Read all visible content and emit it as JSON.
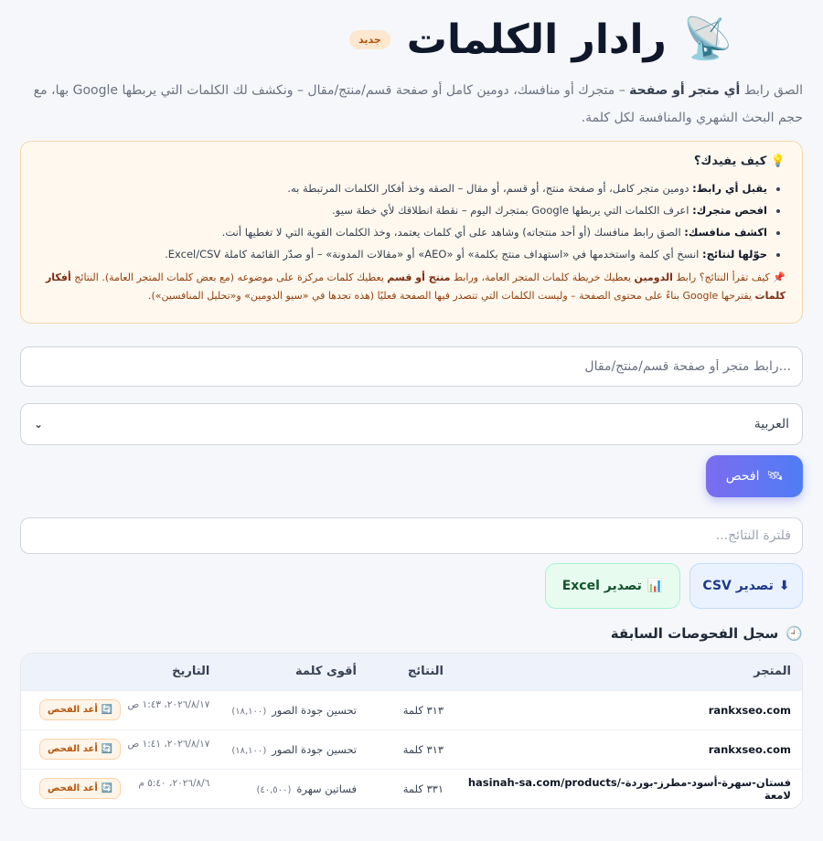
{
  "header": {
    "title": "رادار الكلمات",
    "badge": "جديد",
    "icon": "satellite-dish-icon",
    "subtitle_part1": "الصق رابط ",
    "subtitle_bold": "أي متجر أو صفحة",
    "subtitle_part2": " – متجرك أو منافسك، دومين كامل أو صفحة قسم/منتج/مقال – ونكشف لك الكلمات التي يربطها Google بها، مع حجم البحث الشهري والمنافسة لكل كلمة."
  },
  "info": {
    "title": "💡 كيف يفيدك؟",
    "items": [
      {
        "bold": "يقبل أي رابط:",
        "text": " دومين متجر كامل، أو صفحة منتج، أو قسم، أو مقال – الصقه وخذ أفكار الكلمات المرتبطة به."
      },
      {
        "bold": "افحص متجرك:",
        "text": " اعرف الكلمات التي يربطها Google بمتجرك اليوم – نقطة انطلاقك لأي خطة سيو."
      },
      {
        "bold": "اكشف منافسك:",
        "text": " الصق رابط منافسك (أو أحد منتجاته) وشاهد على أي كلمات يعتمد، وخذ الكلمات القوية التي لا تغطيها أنت."
      },
      {
        "bold": "حوّلها لنتائج:",
        "text": " انسخ أي كلمة واستخدمها في «استهداف منتج بكلمة» أو «AEO» أو «مقالات المدونة» – أو صدّر القائمة كاملة Excel/CSV."
      }
    ],
    "note_a": "📌 كيف تقرأ النتائج؟ رابط ",
    "note_b1": "الدومين",
    "note_c": " يعطيك خريطة كلمات المتجر العامة، ورابط ",
    "note_b2": "منتج أو قسم",
    "note_d": " يعطيك كلمات مركزة على موضوعه (مع بعض كلمات المتجر العامة). النتائج ",
    "note_b3": "أفكار كلمات",
    "note_e": " يقترحها Google بناءً على محتوى الصفحة – وليست الكلمات التي تتصدر فيها الصفحة فعليًا (هذه تجدها في «سيو الدومين» و«تحليل المنافسين»)."
  },
  "form": {
    "url_placeholder": "...رابط متجر أو صفحة قسم/منتج/مقال",
    "language": "العربية",
    "scan_label": "افحص",
    "scan_icon": "🛰",
    "filter_placeholder": "فلترة النتائج..."
  },
  "export": {
    "csv_label": "تصدير CSV",
    "csv_icon": "⬇",
    "excel_label": "تصدير Excel",
    "excel_icon": "📊"
  },
  "history": {
    "title": "سجل الفحوصات السابقة",
    "icon": "🕘",
    "columns": [
      "المتجر",
      "النتائج",
      "أقوى كلمة",
      "التاريخ"
    ],
    "rescan_label": "أعد الفحص",
    "rescan_icon": "🔄",
    "rows": [
      {
        "store": "rankxseo.com",
        "results": "٣١٣ كلمة",
        "keyword": "تحسين جودة الصور",
        "metric": "(١٨,١٠٠)",
        "date": "٢٠٢٦/٨/١٧، ١:٤٣ ص"
      },
      {
        "store": "rankxseo.com",
        "results": "٣١٣ كلمة",
        "keyword": "تحسين جودة الصور",
        "metric": "(١٨,١٠٠)",
        "date": "٢٠٢٦/٨/١٧، ١:٤١ ص"
      },
      {
        "store": "hasinah-sa.com/products/فستان-سهرة-أسود-مطرز-بوردة-لامعة",
        "results": "٣٣١ كلمة",
        "keyword": "فساتين سهرة",
        "metric": "(٤٠,٥٠٠)",
        "date": "٢٠٢٦/٨/٦، ٥:٤٠ م"
      }
    ]
  }
}
